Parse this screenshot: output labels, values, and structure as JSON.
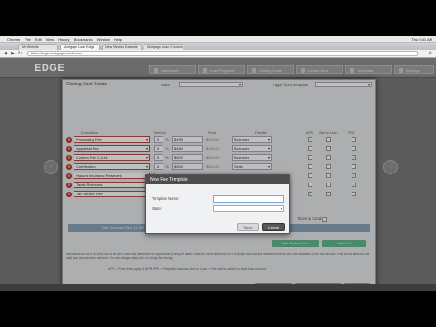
{
  "menubar": {
    "items": [
      "Chrome",
      "File",
      "Edit",
      "View",
      "History",
      "Bookmarks",
      "Window",
      "Help"
    ],
    "clock": "Thu 9:41 AM"
  },
  "browser": {
    "tabs": [
      "My Website",
      "Mortgage Loan Edge",
      "New Window Eastside",
      "Mortgage Loan Connect"
    ],
    "url": "https://edge.mortgagecoach.com/"
  },
  "app": {
    "logo": "EDGE",
    "nav": [
      "Dashboard",
      "Loan Programs",
      "Closing Costs",
      "Lender Fees",
      "Templates",
      "Settings"
    ]
  },
  "dialog": {
    "title": "Closing Cost Details",
    "state_label": "State",
    "state_value": "",
    "template_label": "Apply from Template",
    "template_value": "",
    "columns": {
      "description": "Description",
      "method": "Method",
      "fixed": "Fixed",
      "paid_by": "Paid By",
      "apr": "APR",
      "add_to_loan": "Add to Loan",
      "ppe": "PPE"
    },
    "rows": [
      {
        "desc": "Processing Fee",
        "method": "5",
        "fixed": "$495",
        "amount": "$495.00",
        "paid": "Borrower",
        "apr": true,
        "loan": false,
        "ppe": false
      },
      {
        "desc": "Appraisal Fee",
        "method": "5",
        "fixed": "$450",
        "amount": "$450.00",
        "paid": "Borrower",
        "apr": false,
        "loan": false,
        "ppe": false
      },
      {
        "desc": "Custom Fee 1-4-14",
        "method": "5",
        "fixed": "$500",
        "amount": "$500.00",
        "paid": "Borrower",
        "apr": false,
        "loan": false,
        "ppe": true
      },
      {
        "desc": "Contribution",
        "method": "5",
        "fixed": "$500",
        "amount": "$500.00",
        "paid": "Seller",
        "apr": false,
        "loan": false,
        "ppe": false
      },
      {
        "desc": "Hazard Insurance Reserves",
        "method": "5",
        "fixed": "",
        "amount": "",
        "paid": "",
        "apr": false,
        "loan": false,
        "ppe": true
      },
      {
        "desc": "Taxes Reserves",
        "method": "5",
        "fixed": "",
        "amount": "",
        "paid": "",
        "apr": false,
        "loan": false,
        "ppe": true
      },
      {
        "desc": "Tax Service Fee",
        "method": "5",
        "fixed": "",
        "amount": "",
        "paid": "",
        "apr": true,
        "loan": false,
        "ppe": false
      }
    ],
    "taxes_label": "Taxes & Cond.",
    "totals_text": "Total: Borrower Paid: $1,995.00   Lender Paid: $0.00   Seller Paid: $500.00   Lender Paid: $0.00",
    "add_custom_fee": "Add Custom Fee",
    "add_fee": "Add Fee",
    "note": "Items added to APR will only use to the APR costs that determine the appropriate pricing the table is derived. Items where the APR is proper and that the settlement item for APR will be added to the loan amount. Fees will be added to the total loan amount when selected. You can change at any time or during the closing.",
    "legend": "APR = Fees that apply to APR   PPE = Prepaids escrows   Add to Loan = Fee will be added to total loan amount",
    "btn_apply": "Apply to Loan",
    "btn_save_template": "Save as Template",
    "btn_cancel": "Cancel"
  },
  "modal": {
    "title": "New Fee Template",
    "name_label": "Template Name:",
    "name_value": "",
    "state_label": "State:",
    "state_value": "",
    "save": "Save",
    "cancel": "Cancel"
  }
}
